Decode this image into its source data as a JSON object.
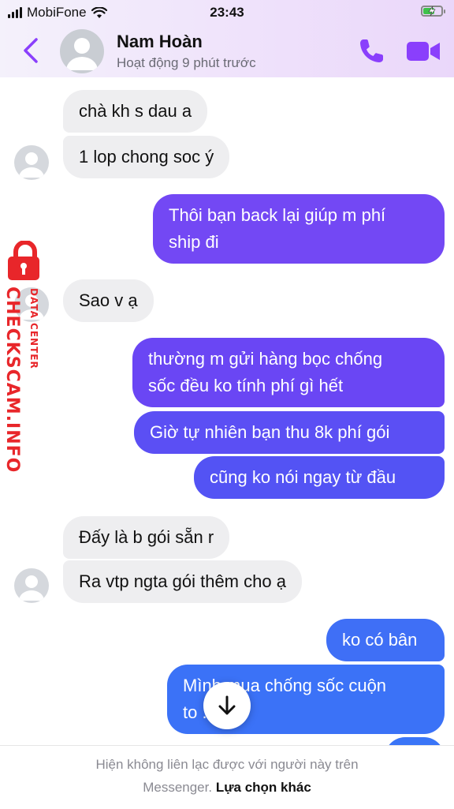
{
  "status_bar": {
    "carrier": "MobiFone",
    "time": "23:43"
  },
  "header": {
    "contact_name": "Nam Hoàn",
    "activity": "Hoạt động 9 phút trước",
    "icons": {
      "back": "back-chevron-icon",
      "call": "phone-icon",
      "video": "video-camera-icon"
    },
    "accent_color": "#8a3ffc"
  },
  "messages": [
    {
      "from": "them",
      "text": "chà kh s dau a"
    },
    {
      "from": "them",
      "text": "1 lop chong soc ý"
    },
    {
      "from": "me",
      "lines": [
        "Thôi bạn back lại giúp m phí",
        "ship đi"
      ]
    },
    {
      "from": "them",
      "text": "Sao v ạ"
    },
    {
      "from": "me",
      "lines": [
        "thường m gửi hàng bọc chống",
        "sốc đều ko tính phí gì hết"
      ]
    },
    {
      "from": "me",
      "text": "Giờ tự nhiên bạn thu 8k phí gói"
    },
    {
      "from": "me",
      "text": "cũng ko nói ngay từ đầu"
    },
    {
      "from": "them",
      "text": "Đấy là b gói sẵn r"
    },
    {
      "from": "them",
      "text": "Ra vtp ngta gói thêm cho ạ"
    },
    {
      "from": "me",
      "text": "ko có bân"
    },
    {
      "from": "me",
      "lines": [
        "Mình mua chống sốc cuộn",
        "to ... gv"
      ]
    }
  ],
  "watermark": {
    "main": "CHECKSCAM.INFO",
    "sub": "DATA CENTER"
  },
  "footer": {
    "notice": "Hiện không liên lạc được với người này trên",
    "notice_end": "Messenger.",
    "link": "Lựa chọn khác"
  }
}
